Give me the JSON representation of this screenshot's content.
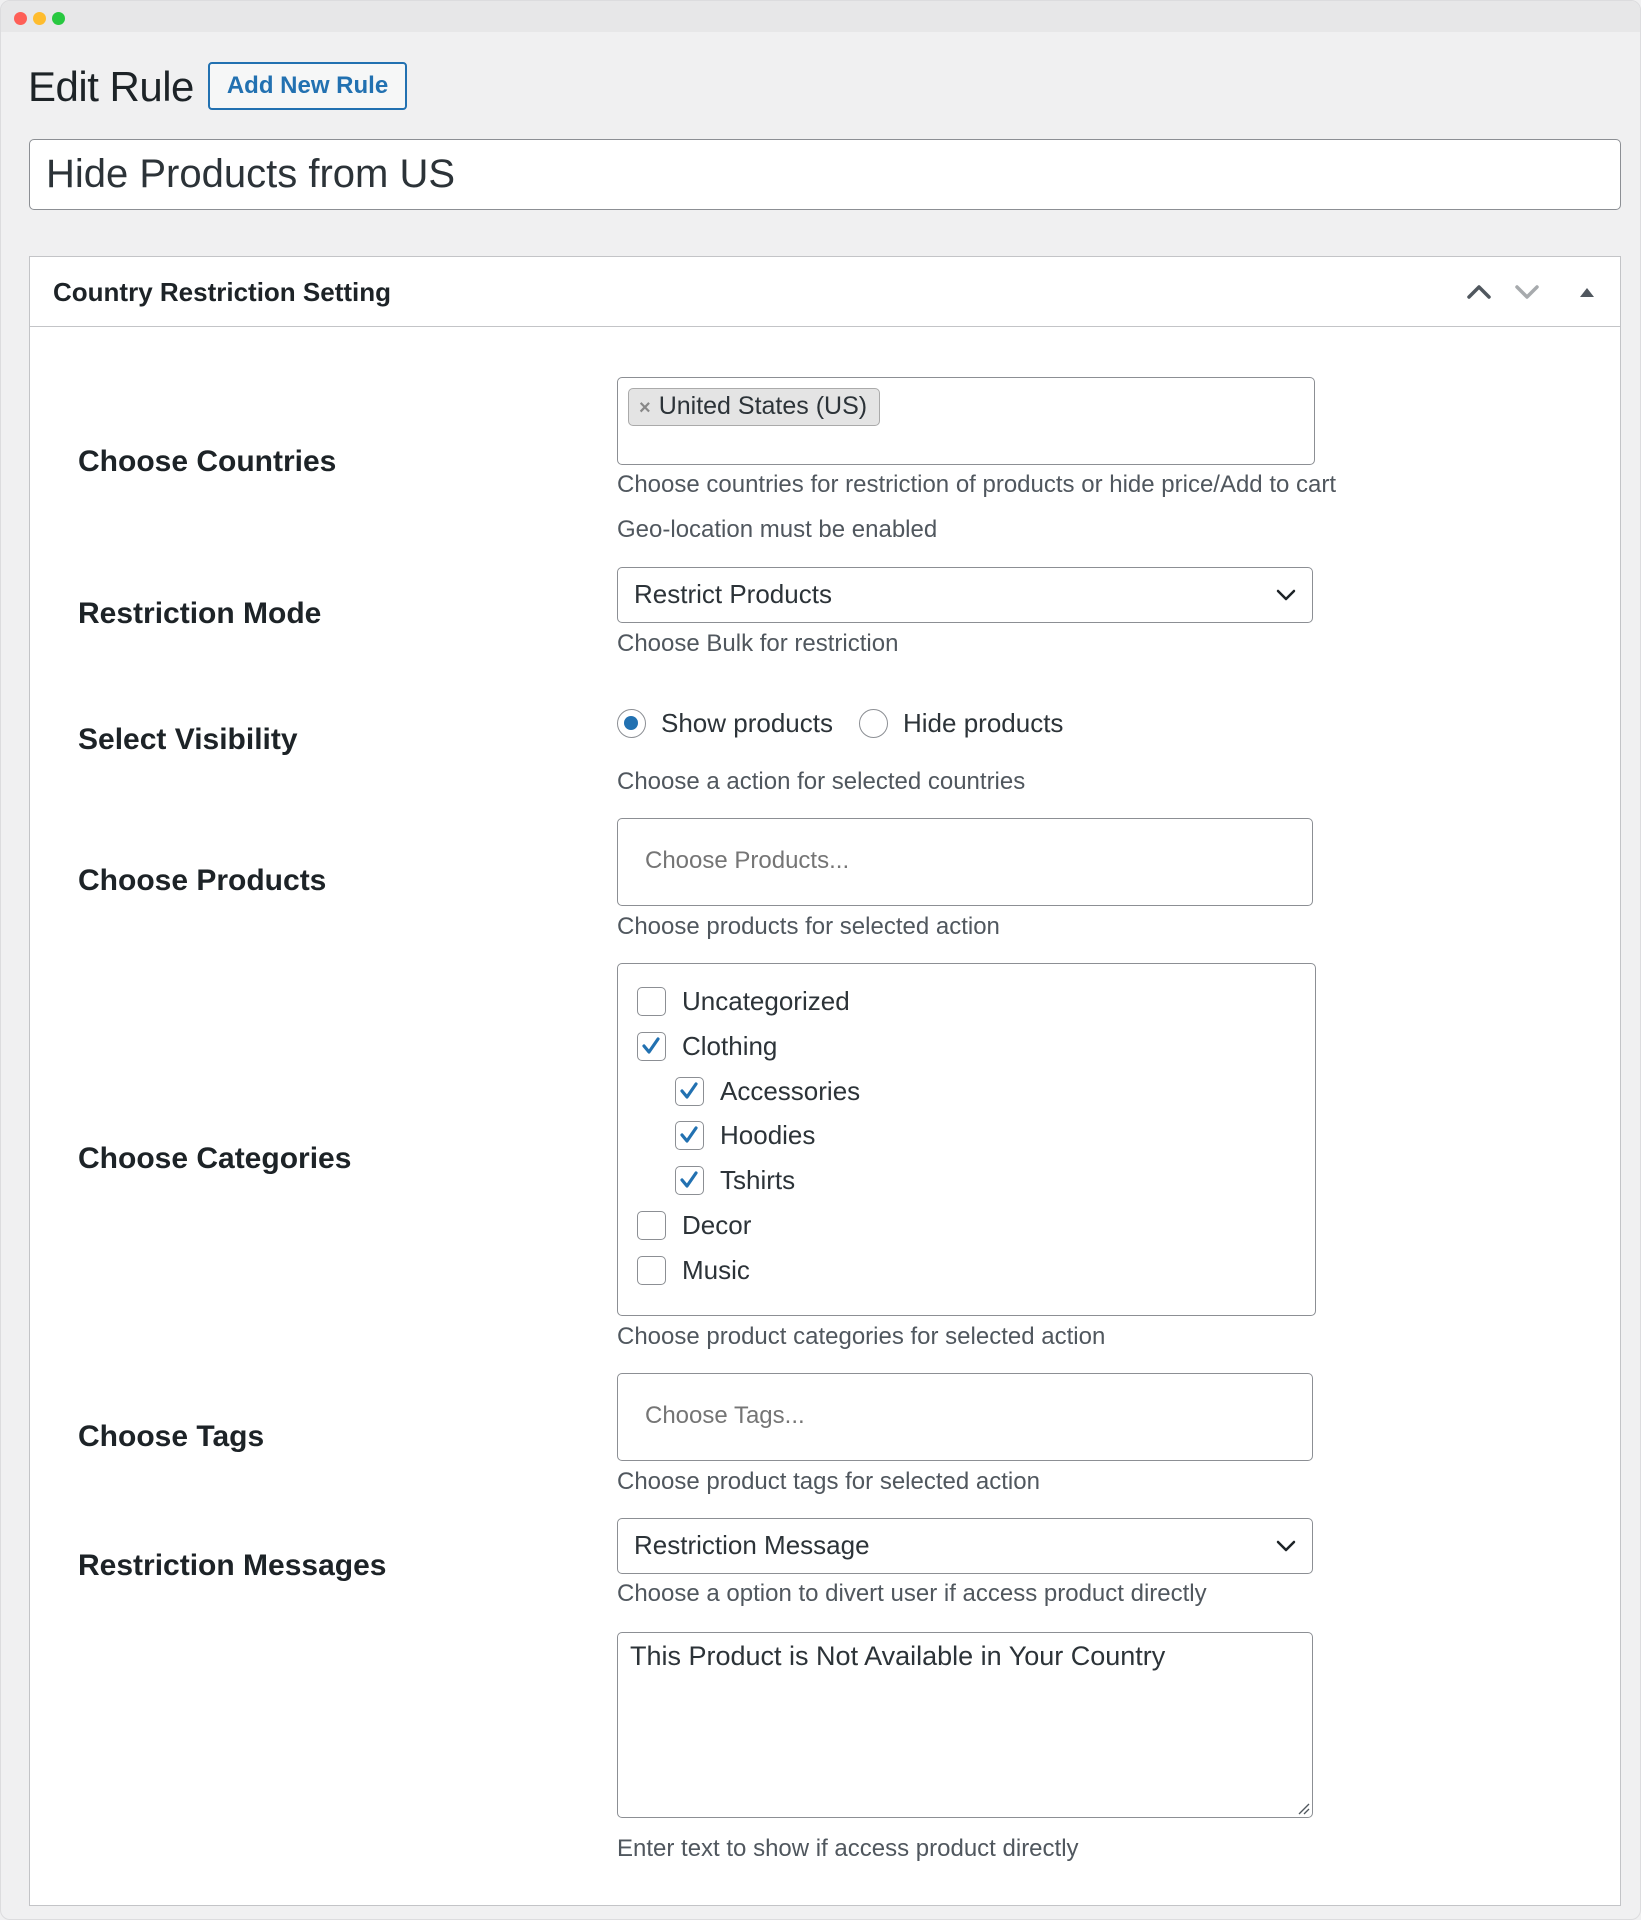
{
  "window": {
    "controls": [
      "close",
      "minimize",
      "maximize"
    ]
  },
  "header": {
    "title": "Edit Rule",
    "add_new_label": "Add New Rule"
  },
  "rule_title": {
    "value": "Hide Products from US"
  },
  "postbox": {
    "title": "Country Restriction Setting",
    "controls": {
      "move_up": "chevron-up-icon",
      "move_down": "chevron-down-icon",
      "toggle": "triangle-up-icon"
    }
  },
  "fields": {
    "countries": {
      "label": "Choose Countries",
      "selected": [
        {
          "name": "United States (US)",
          "remove": "×"
        }
      ],
      "description": "Choose countries for restriction of products or hide price/Add to cart",
      "note": "Geo-location must be enabled"
    },
    "restriction_mode": {
      "label": "Restriction Mode",
      "selected": "Restrict Products",
      "description": "Choose Bulk for restriction"
    },
    "visibility": {
      "label": "Select Visibility",
      "options": [
        {
          "label": "Show products",
          "checked": true
        },
        {
          "label": "Hide products",
          "checked": false
        }
      ],
      "description": "Choose a action for selected countries"
    },
    "products": {
      "label": "Choose Products",
      "placeholder": "Choose Products...",
      "description": "Choose products for selected action"
    },
    "categories": {
      "label": "Choose Categories",
      "items": [
        {
          "label": "Uncategorized",
          "checked": false,
          "level": 0
        },
        {
          "label": "Clothing",
          "checked": true,
          "level": 0
        },
        {
          "label": "Accessories",
          "checked": true,
          "level": 1
        },
        {
          "label": "Hoodies",
          "checked": true,
          "level": 1
        },
        {
          "label": "Tshirts",
          "checked": true,
          "level": 1
        },
        {
          "label": "Decor",
          "checked": false,
          "level": 0
        },
        {
          "label": "Music",
          "checked": false,
          "level": 0
        }
      ],
      "description": "Choose product categories for selected action"
    },
    "tags": {
      "label": "Choose Tags",
      "placeholder": "Choose Tags...",
      "description": "Choose product tags for selected action"
    },
    "messages": {
      "label": "Restriction Messages",
      "selected": "Restriction Message",
      "description": "Choose a option to divert user if access product directly",
      "message_text": "This Product is Not Available in Your Country",
      "message_description": "Enter text to show if access product directly"
    }
  },
  "colors": {
    "accent": "#2271b1",
    "background": "#f0f0f1",
    "text": "#1d2327",
    "muted_text": "#50575e",
    "border": "#8c8f94"
  }
}
